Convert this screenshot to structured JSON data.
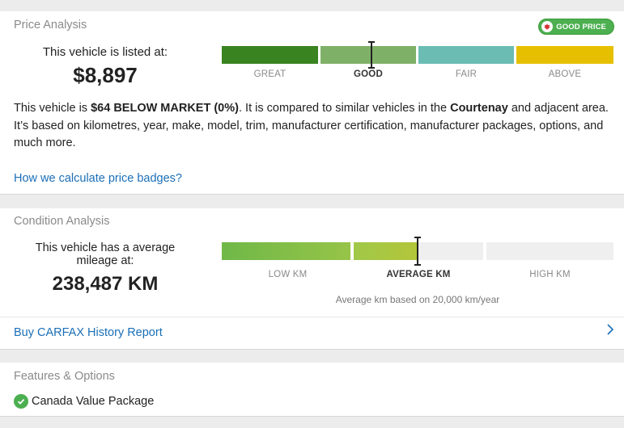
{
  "price_analysis": {
    "title": "Price Analysis",
    "badge_label": "GOOD PRICE",
    "listed_label": "This vehicle is listed at:",
    "price": "$8,897",
    "scale": {
      "segments": [
        {
          "label": "GREAT",
          "color": "#3a8321"
        },
        {
          "label": "GOOD",
          "color": "#7fb068"
        },
        {
          "label": "FAIR",
          "color": "#6bbdb4"
        },
        {
          "label": "ABOVE",
          "color": "#e6c000"
        }
      ],
      "active_segment": "GOOD",
      "marker_position_fraction": 0.38
    },
    "description": {
      "part1": "This vehicle is ",
      "highlight": "$64 BELOW MARKET (0%)",
      "part2": ". It is compared to similar vehicles in the ",
      "location": "Courtenay",
      "part3": " and adjacent area. It’s based on kilometres, year, make, model, trim, manufacturer certification, manufacturer packages, options, and much more."
    },
    "link_text": "How we calculate price badges?"
  },
  "condition_analysis": {
    "title": "Condition Analysis",
    "mileage_label": "This vehicle has a average mileage at:",
    "mileage_value": "238,487 KM",
    "scale": {
      "segments": [
        {
          "label": "LOW KM"
        },
        {
          "label": "AVERAGE KM"
        },
        {
          "label": "HIGH KM"
        }
      ],
      "active_segment": "AVERAGE KM",
      "marker_position_fraction": 0.5
    },
    "note": "Average km based on 20,000 km/year",
    "report_link": "Buy CARFAX History Report"
  },
  "features": {
    "title": "Features & Options",
    "items": [
      "Canada Value Package"
    ]
  }
}
